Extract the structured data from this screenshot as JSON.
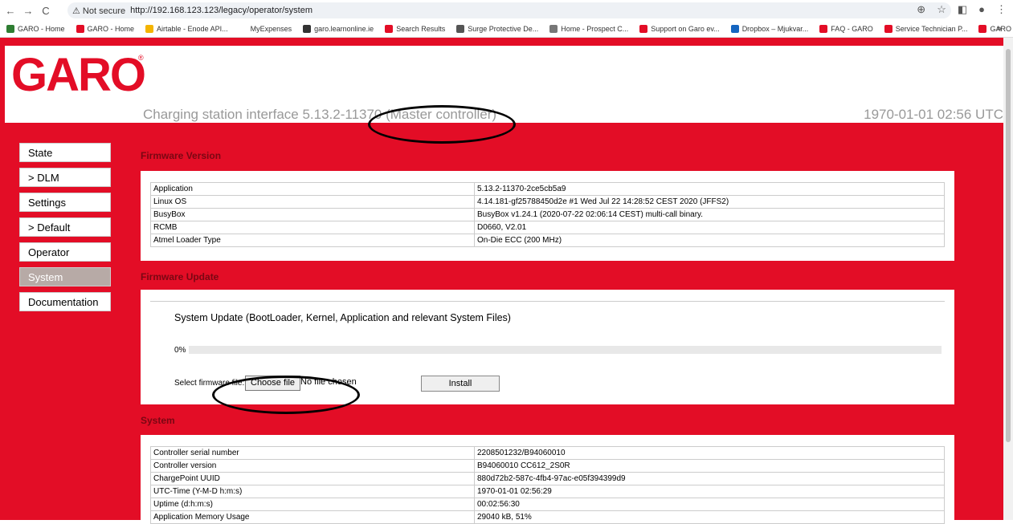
{
  "browser": {
    "security": "Not secure",
    "url": "http://192.168.123.123/legacy/operator/system",
    "bookmarks": [
      {
        "label": "GARO - Home",
        "color": "#2e7d32"
      },
      {
        "label": "GARO - Home",
        "color": "#e30d26"
      },
      {
        "label": "Airtable - Enode API...",
        "color": "#f4b400"
      },
      {
        "label": "MyExpenses",
        "color": "#ffffff"
      },
      {
        "label": "garo.learnonline.ie",
        "color": "#333333"
      },
      {
        "label": "Search Results",
        "color": "#e30d26"
      },
      {
        "label": "Surge Protective De...",
        "color": "#555555"
      },
      {
        "label": "Home - Prospect C...",
        "color": "#777777"
      },
      {
        "label": "Support on Garo ev...",
        "color": "#e30d26"
      },
      {
        "label": "Dropbox – Mjukvar...",
        "color": "#1565c0"
      },
      {
        "label": "FAQ - GARO",
        "color": "#e30d26"
      },
      {
        "label": "Service Technician P...",
        "color": "#e30d26"
      },
      {
        "label": "GARO Electric Vehic...",
        "color": "#e30d26"
      }
    ],
    "more": "»"
  },
  "header": {
    "logo": "GARO",
    "reg": "®",
    "title": "Charging station interface 5.13.2-11370 (Master controller)",
    "time": "1970-01-01 02:56 UTC"
  },
  "menu": [
    "State",
    "> DLM",
    "Settings",
    "> Default",
    "Operator",
    "System",
    "Documentation"
  ],
  "firmware_version": {
    "title": "Firmware Version",
    "rows": [
      [
        "Application",
        "5.13.2-11370-2ce5cb5a9"
      ],
      [
        "Linux OS",
        "4.14.181-gf25788450d2e #1 Wed Jul 22 14:28:52 CEST 2020 (JFFS2)"
      ],
      [
        "BusyBox",
        "BusyBox v1.24.1 (2020-07-22 02:06:14 CEST) multi-call binary."
      ],
      [
        "RCMB",
        "D0660, V2.01"
      ],
      [
        "Atmel Loader Type",
        "On-Die ECC (200 MHz)"
      ]
    ]
  },
  "firmware_update": {
    "title": "Firmware Update",
    "heading": "System Update (BootLoader, Kernel, Application and relevant System Files)",
    "progress_text": "0%",
    "progress": 0,
    "select_label": "Select firmware file:",
    "choose_file": "Choose file",
    "no_file": "No file chosen",
    "install": "Install"
  },
  "system": {
    "title": "System",
    "rows": [
      [
        "Controller serial number",
        "2208501232/B94060010"
      ],
      [
        "Controller version",
        "B94060010 CC612_2S0R"
      ],
      [
        "ChargePoint UUID",
        "880d72b2-587c-4fb4-97ac-e05f394399d9"
      ],
      [
        "UTC-Time (Y-M-D h:m:s)",
        "1970-01-01 02:56:29"
      ],
      [
        "Uptime (d:h:m:s)",
        "00:02:56:30"
      ],
      [
        "Application Memory Usage",
        "29040 kB, 51%"
      ]
    ]
  }
}
